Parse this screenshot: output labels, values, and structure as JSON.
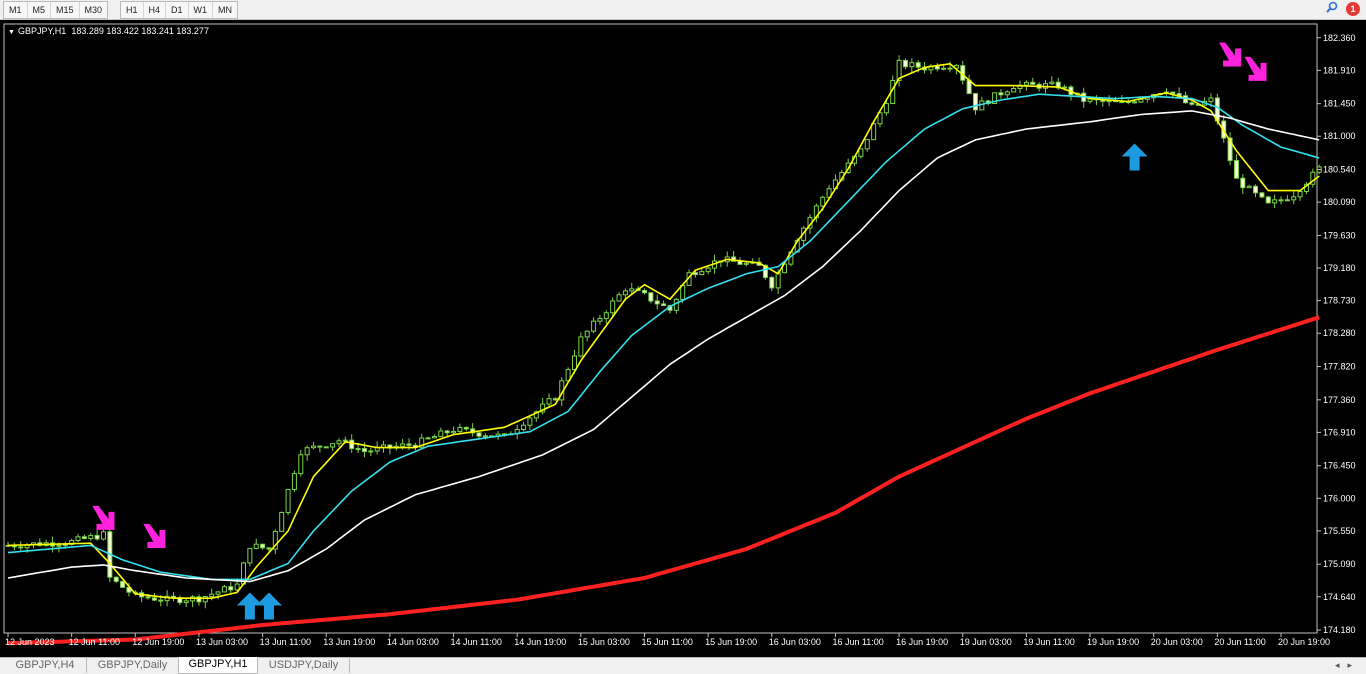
{
  "toolbar": {
    "timeframes_left": [
      "M1",
      "M5",
      "M15",
      "M30"
    ],
    "timeframes_right": [
      "H1",
      "H4",
      "D1",
      "W1",
      "MN"
    ],
    "notification_count": "1"
  },
  "chart": {
    "symbol_label": "GBPJPY,H1",
    "ohlc": "183.289 183.422 183.241 183.277"
  },
  "chart_data": {
    "type": "candlestick",
    "symbol": "GBPJPY",
    "timeframe": "H1",
    "ylim": [
      174.14,
      182.55
    ],
    "price_ticks": [
      "182.360",
      "181.910",
      "181.450",
      "181.000",
      "180.540",
      "180.090",
      "179.630",
      "179.180",
      "178.730",
      "178.280",
      "177.820",
      "177.360",
      "176.910",
      "176.450",
      "176.000",
      "175.550",
      "175.090",
      "174.640",
      "174.180"
    ],
    "time_ticks": [
      "12 Jun 2023",
      "12 Jun 11:00",
      "12 Jun 19:00",
      "13 Jun 03:00",
      "13 Jun 11:00",
      "13 Jun 19:00",
      "14 Jun 03:00",
      "14 Jun 11:00",
      "14 Jun 19:00",
      "15 Jun 03:00",
      "15 Jun 11:00",
      "15 Jun 19:00",
      "16 Jun 03:00",
      "16 Jun 11:00",
      "16 Jun 19:00",
      "19 Jun 03:00",
      "19 Jun 11:00",
      "19 Jun 19:00",
      "20 Jun 03:00",
      "20 Jun 11:00",
      "20 Jun 19:00"
    ],
    "close_path": [
      [
        0,
        175.35
      ],
      [
        10,
        175.4
      ],
      [
        15,
        175.5
      ],
      [
        16,
        174.9
      ],
      [
        20,
        174.65
      ],
      [
        25,
        174.6
      ],
      [
        30,
        174.62
      ],
      [
        36,
        174.8
      ],
      [
        38,
        175.35
      ],
      [
        41,
        175.3
      ],
      [
        46,
        176.65
      ],
      [
        52,
        176.8
      ],
      [
        56,
        176.65
      ],
      [
        64,
        176.75
      ],
      [
        70,
        176.95
      ],
      [
        78,
        176.85
      ],
      [
        86,
        177.4
      ],
      [
        90,
        178.2
      ],
      [
        97,
        178.9
      ],
      [
        100,
        178.8
      ],
      [
        104,
        178.6
      ],
      [
        107,
        179.1
      ],
      [
        112,
        179.3
      ],
      [
        118,
        179.2
      ],
      [
        120,
        178.95
      ],
      [
        124,
        179.6
      ],
      [
        129,
        180.3
      ],
      [
        134,
        180.8
      ],
      [
        138,
        181.5
      ],
      [
        140,
        182.0
      ],
      [
        144,
        181.95
      ],
      [
        149,
        182.0
      ],
      [
        152,
        181.4
      ],
      [
        158,
        181.7
      ],
      [
        165,
        181.7
      ],
      [
        169,
        181.5
      ],
      [
        175,
        181.45
      ],
      [
        182,
        181.65
      ],
      [
        186,
        181.4
      ],
      [
        189,
        181.5
      ],
      [
        193,
        180.4
      ],
      [
        198,
        180.05
      ],
      [
        202,
        180.2
      ],
      [
        206,
        180.55
      ]
    ],
    "series": [
      {
        "color": "#ffff00",
        "values": [
          [
            0,
            175.35
          ],
          [
            13,
            175.38
          ],
          [
            16,
            175.1
          ],
          [
            20,
            174.68
          ],
          [
            26,
            174.62
          ],
          [
            32,
            174.62
          ],
          [
            36,
            174.7
          ],
          [
            39,
            175.05
          ],
          [
            44,
            175.55
          ],
          [
            48,
            176.3
          ],
          [
            53,
            176.78
          ],
          [
            58,
            176.7
          ],
          [
            64,
            176.7
          ],
          [
            70,
            176.88
          ],
          [
            78,
            176.98
          ],
          [
            86,
            177.3
          ],
          [
            90,
            177.9
          ],
          [
            97,
            178.75
          ],
          [
            100,
            178.95
          ],
          [
            104,
            178.75
          ],
          [
            108,
            179.15
          ],
          [
            113,
            179.3
          ],
          [
            118,
            179.25
          ],
          [
            121,
            179.1
          ],
          [
            124,
            179.55
          ],
          [
            128,
            180.0
          ],
          [
            132,
            180.55
          ],
          [
            136,
            181.2
          ],
          [
            140,
            181.8
          ],
          [
            144,
            181.95
          ],
          [
            148,
            182.0
          ],
          [
            152,
            181.7
          ],
          [
            158,
            181.7
          ],
          [
            165,
            181.68
          ],
          [
            170,
            181.52
          ],
          [
            176,
            181.48
          ],
          [
            182,
            181.6
          ],
          [
            186,
            181.5
          ],
          [
            189,
            181.35
          ],
          [
            193,
            180.8
          ],
          [
            198,
            180.25
          ],
          [
            203,
            180.25
          ],
          [
            206,
            180.45
          ]
        ]
      },
      {
        "color": "#33e0ee",
        "values": [
          [
            0,
            175.25
          ],
          [
            13,
            175.35
          ],
          [
            18,
            175.15
          ],
          [
            24,
            174.98
          ],
          [
            32,
            174.88
          ],
          [
            38,
            174.88
          ],
          [
            44,
            175.1
          ],
          [
            48,
            175.55
          ],
          [
            54,
            176.1
          ],
          [
            60,
            176.5
          ],
          [
            66,
            176.72
          ],
          [
            74,
            176.82
          ],
          [
            82,
            176.92
          ],
          [
            88,
            177.2
          ],
          [
            93,
            177.75
          ],
          [
            98,
            178.25
          ],
          [
            104,
            178.65
          ],
          [
            110,
            178.9
          ],
          [
            116,
            179.1
          ],
          [
            121,
            179.2
          ],
          [
            126,
            179.55
          ],
          [
            132,
            180.1
          ],
          [
            138,
            180.65
          ],
          [
            144,
            181.1
          ],
          [
            150,
            181.38
          ],
          [
            156,
            181.5
          ],
          [
            162,
            181.58
          ],
          [
            168,
            181.55
          ],
          [
            174,
            181.52
          ],
          [
            180,
            181.55
          ],
          [
            186,
            181.52
          ],
          [
            190,
            181.4
          ],
          [
            194,
            181.15
          ],
          [
            200,
            180.85
          ],
          [
            206,
            180.7
          ]
        ]
      },
      {
        "color": "#ffffff",
        "values": [
          [
            0,
            174.9
          ],
          [
            10,
            175.05
          ],
          [
            15,
            175.08
          ],
          [
            20,
            175.0
          ],
          [
            28,
            174.9
          ],
          [
            38,
            174.85
          ],
          [
            44,
            175.0
          ],
          [
            50,
            175.3
          ],
          [
            56,
            175.7
          ],
          [
            64,
            176.05
          ],
          [
            74,
            176.3
          ],
          [
            84,
            176.6
          ],
          [
            92,
            176.95
          ],
          [
            98,
            177.4
          ],
          [
            104,
            177.85
          ],
          [
            110,
            178.2
          ],
          [
            116,
            178.5
          ],
          [
            122,
            178.8
          ],
          [
            128,
            179.2
          ],
          [
            134,
            179.7
          ],
          [
            140,
            180.25
          ],
          [
            146,
            180.7
          ],
          [
            152,
            180.95
          ],
          [
            160,
            181.1
          ],
          [
            170,
            181.2
          ],
          [
            178,
            181.3
          ],
          [
            186,
            181.35
          ],
          [
            192,
            181.25
          ],
          [
            198,
            181.1
          ],
          [
            206,
            180.95
          ]
        ]
      },
      {
        "color": "#ff2020",
        "values": [
          [
            0,
            174.0
          ],
          [
            20,
            174.05
          ],
          [
            30,
            174.15
          ],
          [
            40,
            174.25
          ],
          [
            60,
            174.4
          ],
          [
            80,
            174.6
          ],
          [
            100,
            174.9
          ],
          [
            116,
            175.3
          ],
          [
            130,
            175.8
          ],
          [
            140,
            176.3
          ],
          [
            150,
            176.7
          ],
          [
            160,
            177.1
          ],
          [
            170,
            177.45
          ],
          [
            180,
            177.75
          ],
          [
            190,
            178.05
          ],
          [
            206,
            178.5
          ]
        ]
      }
    ],
    "signals": [
      {
        "type": "sell",
        "i": 15,
        "price": 175.55
      },
      {
        "type": "sell",
        "i": 23,
        "price": 175.3
      },
      {
        "type": "buy",
        "i": 38,
        "price": 174.7
      },
      {
        "type": "buy",
        "i": 41,
        "price": 174.7
      },
      {
        "type": "buy",
        "i": 177,
        "price": 180.9
      },
      {
        "type": "sell",
        "i": 192,
        "price": 181.95
      },
      {
        "type": "sell",
        "i": 196,
        "price": 181.75
      }
    ]
  },
  "tabs": [
    {
      "label": "GBPJPY,H4",
      "active": false
    },
    {
      "label": "GBPJPY,Daily",
      "active": false
    },
    {
      "label": "GBPJPY,H1",
      "active": true
    },
    {
      "label": "USDJPY,Daily",
      "active": false
    }
  ]
}
